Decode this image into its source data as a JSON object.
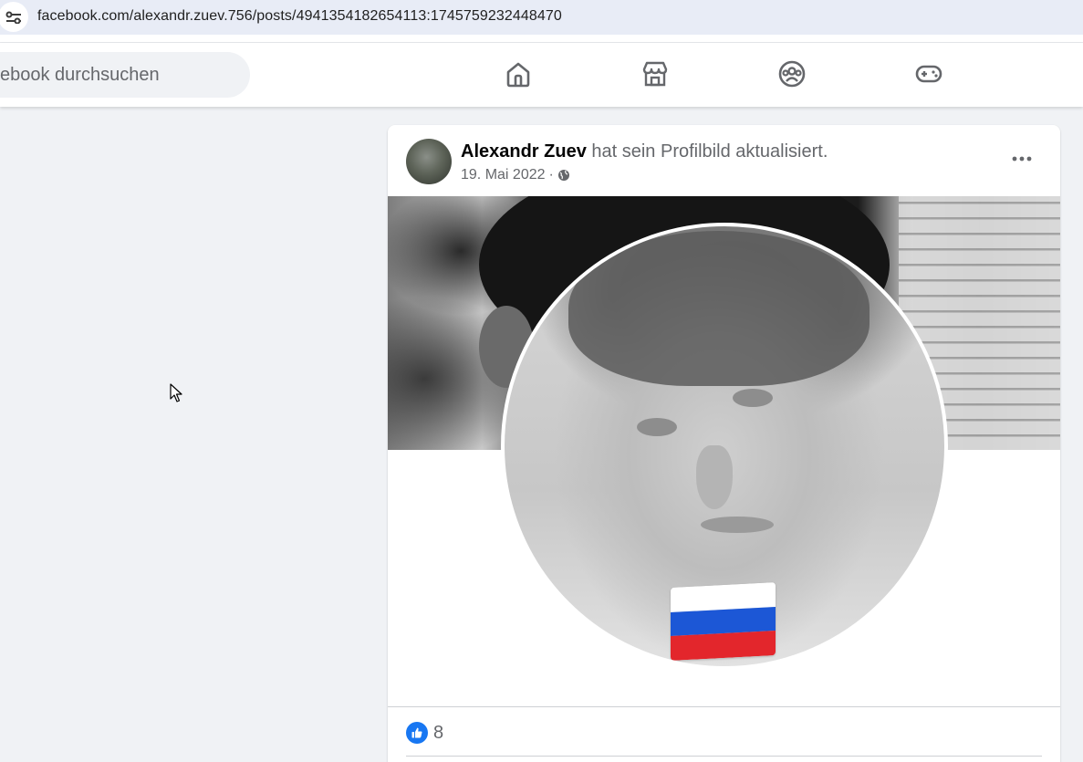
{
  "browser": {
    "url": "facebook.com/alexandr.zuev.756/posts/4941354182654113:1745759232448470",
    "site_settings_icon": "tune-icon"
  },
  "nav": {
    "search_placeholder": "ebook durchsuchen",
    "icons": [
      "home-icon",
      "marketplace-icon",
      "groups-icon",
      "gaming-icon"
    ]
  },
  "post": {
    "author": "Alexandr Zuev",
    "action": " hat sein Profilbild aktualisiert.",
    "date": "19. Mai 2022",
    "separator": " · ",
    "audience_icon": "globe-icon",
    "more_icon": "more-horizontal-icon",
    "flag_colors": [
      "#ffffff",
      "#1c57d6",
      "#e3262c"
    ],
    "reactions": {
      "icon": "like-icon",
      "count": "8"
    }
  },
  "colors": {
    "accent": "#1877f2",
    "page_bg": "#f0f2f5",
    "text_secondary": "#65676b"
  }
}
